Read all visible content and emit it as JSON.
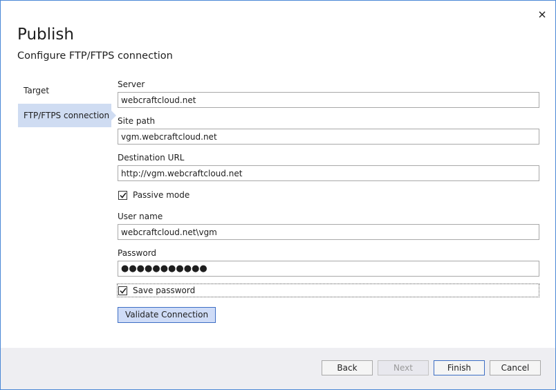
{
  "dialog": {
    "title": "Publish",
    "subtitle": "Configure FTP/FTPS connection",
    "close_icon": "close-icon"
  },
  "nav": {
    "items": [
      {
        "label": "Target",
        "active": false
      },
      {
        "label": "FTP/FTPS connection",
        "active": true
      }
    ]
  },
  "form": {
    "server": {
      "label": "Server",
      "value": "webcraftcloud.net"
    },
    "site_path": {
      "label": "Site path",
      "value": "vgm.webcraftcloud.net"
    },
    "destination_url": {
      "label": "Destination URL",
      "value": "http://vgm.webcraftcloud.net"
    },
    "passive_mode": {
      "label": "Passive mode",
      "checked": true
    },
    "user_name": {
      "label": "User name",
      "value": "webcraftcloud.net\\vgm"
    },
    "password": {
      "label": "Password",
      "value": "●●●●●●●●●●●"
    },
    "save_password": {
      "label": "Save password",
      "checked": true
    },
    "validate_button": "Validate Connection"
  },
  "footer": {
    "back": "Back",
    "next": "Next",
    "finish": "Finish",
    "cancel": "Cancel"
  },
  "colors": {
    "accent_border": "#3c6dc4",
    "nav_active_bg": "#cfdcf2",
    "footer_bg": "#eeeef2"
  }
}
